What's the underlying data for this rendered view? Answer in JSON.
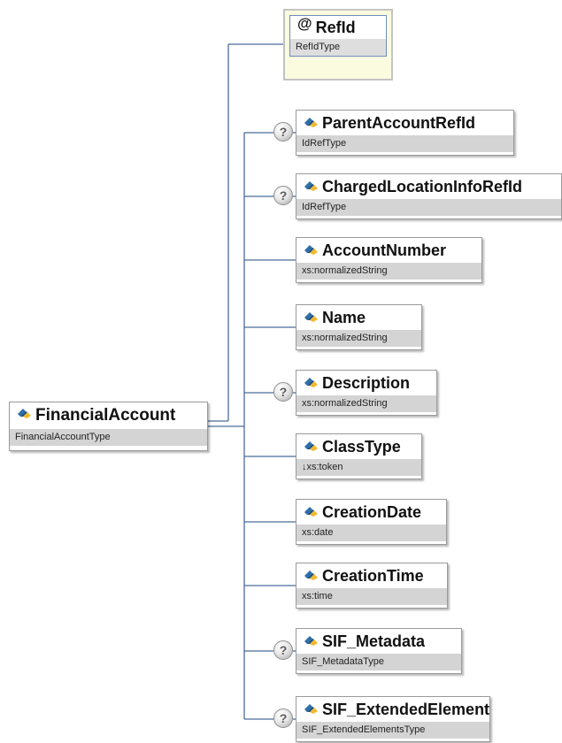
{
  "root": {
    "name": "FinancialAccount",
    "type": "FinancialAccountType",
    "icon": "element-icon"
  },
  "attribute": {
    "marker": "@",
    "name": "RefId",
    "type": "RefIdType",
    "icon": "attribute-icon"
  },
  "optional_marker": "?",
  "elements": [
    {
      "name": "ParentAccountRefId",
      "type": "IdRefType",
      "optional": true
    },
    {
      "name": "ChargedLocationInfoRefId",
      "type": "IdRefType",
      "optional": true
    },
    {
      "name": "AccountNumber",
      "type": "xs:normalizedString",
      "optional": false
    },
    {
      "name": "Name",
      "type": "xs:normalizedString",
      "optional": false
    },
    {
      "name": "Description",
      "type": "xs:normalizedString",
      "optional": true
    },
    {
      "name": "ClassType",
      "type": "↓xs:token",
      "optional": false
    },
    {
      "name": "CreationDate",
      "type": "xs:date",
      "optional": false
    },
    {
      "name": "CreationTime",
      "type": "xs:time",
      "optional": false
    },
    {
      "name": "SIF_Metadata",
      "type": "SIF_MetadataType",
      "optional": true
    },
    {
      "name": "SIF_ExtendedElements",
      "type": "SIF_ExtendedElementsType",
      "optional": true
    }
  ],
  "colors": {
    "connector": "#4a6c9b",
    "icon_blue": "#2f6ea8",
    "icon_yellow": "#f2b82c"
  }
}
